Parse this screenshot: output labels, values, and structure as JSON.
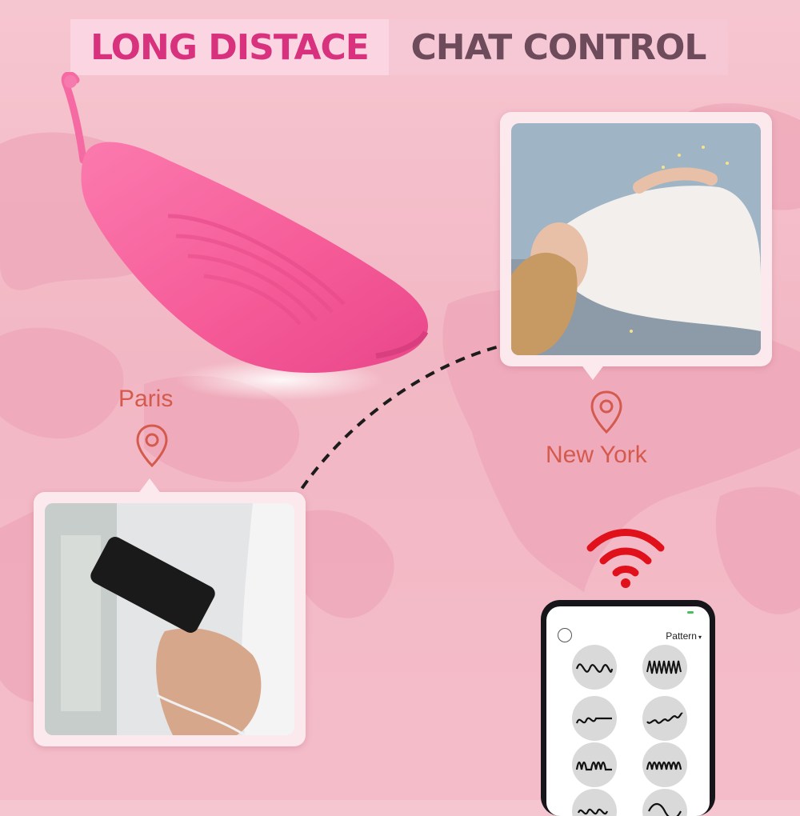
{
  "title": {
    "part_a": "LONG DISTACE",
    "part_b": "CHAT CONTROL"
  },
  "cities": {
    "origin": "Paris",
    "destination": "New York"
  },
  "phone_app": {
    "header_label": "Pattern",
    "dropdown_caret": "▾",
    "patterns": [
      "wave-smooth",
      "wave-dense",
      "wave-step",
      "wave-rising",
      "wave-burst",
      "wave-pulse",
      "wave-partial-a",
      "wave-partial-b"
    ]
  },
  "colors": {
    "title_accent": "#d8327f",
    "title_dark": "#6e4b5b",
    "city_label": "#d45a4d",
    "wifi": "#e0111a",
    "product": "#f5679e"
  }
}
